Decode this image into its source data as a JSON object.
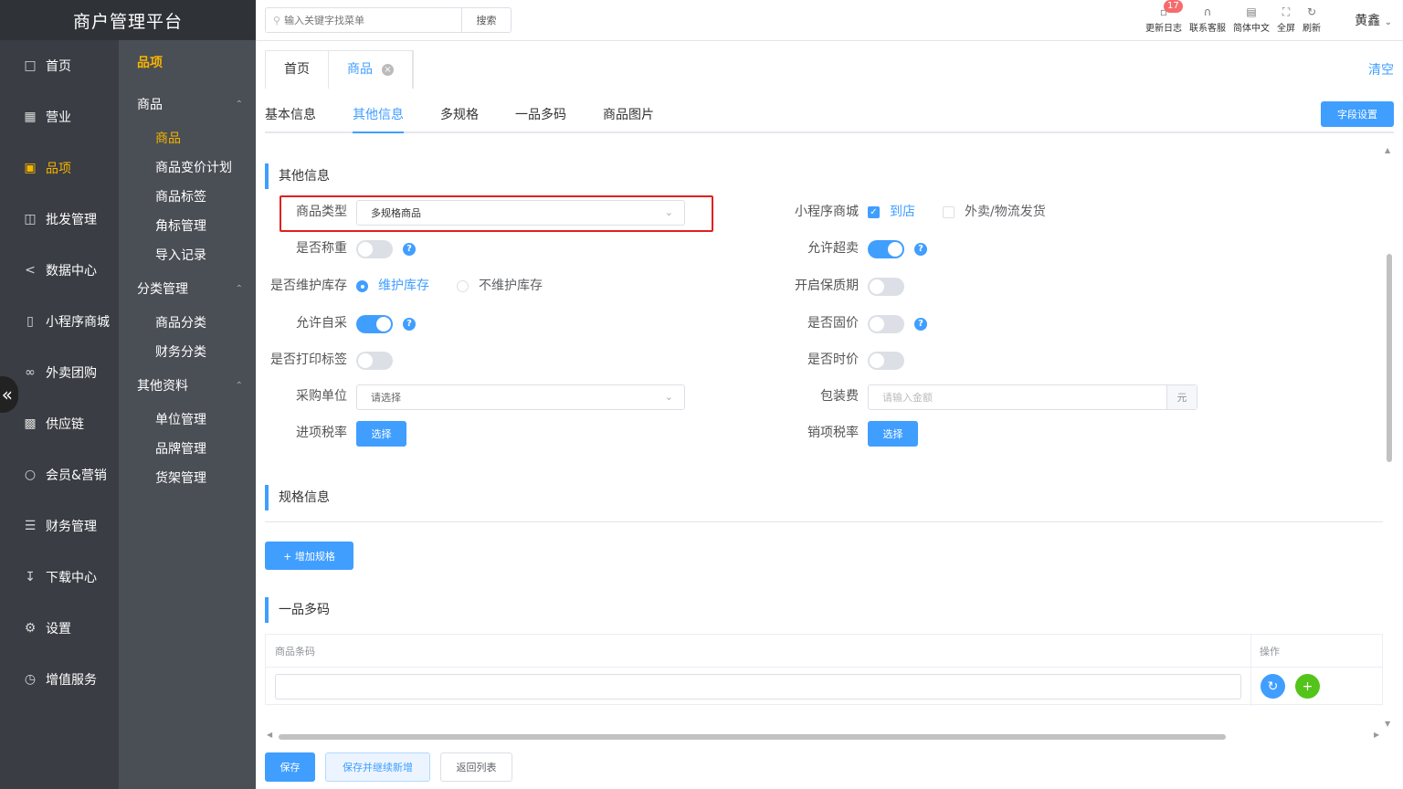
{
  "brand": "商户管理平台",
  "nav": [
    {
      "label": "首页",
      "icon": "home-icon"
    },
    {
      "label": "营业",
      "icon": "calendar-icon"
    },
    {
      "label": "品项",
      "icon": "bag-icon",
      "active": true
    },
    {
      "label": "批发管理",
      "icon": "cart-icon"
    },
    {
      "label": "数据中心",
      "icon": "share-icon"
    },
    {
      "label": "小程序商城",
      "icon": "phone-icon"
    },
    {
      "label": "外卖团购",
      "icon": "bike-icon"
    },
    {
      "label": "供应链",
      "icon": "truck-icon"
    },
    {
      "label": "会员&营销",
      "icon": "user-icon"
    },
    {
      "label": "财务管理",
      "icon": "database-icon"
    },
    {
      "label": "下载中心",
      "icon": "download-icon"
    },
    {
      "label": "设置",
      "icon": "gear-icon"
    },
    {
      "label": "增值服务",
      "icon": "clock-icon"
    }
  ],
  "subnav": {
    "title": "品项",
    "groups": [
      {
        "label": "商品",
        "items": [
          "商品",
          "商品变价计划",
          "商品标签",
          "角标管理",
          "导入记录"
        ]
      },
      {
        "label": "分类管理",
        "items": [
          "商品分类",
          "财务分类"
        ]
      },
      {
        "label": "其他资料",
        "items": [
          "单位管理",
          "品牌管理",
          "货架管理"
        ]
      }
    ]
  },
  "header": {
    "search_placeholder": "输入关键字找菜单",
    "search_button": "搜索",
    "tools": [
      {
        "label": "更新日志",
        "icon": "log-icon",
        "badge": "17"
      },
      {
        "label": "联系客服",
        "icon": "headset-icon"
      },
      {
        "label": "简体中文",
        "icon": "language-icon"
      },
      {
        "label": "全屏",
        "icon": "fullscreen-icon"
      },
      {
        "label": "刷新",
        "icon": "refresh-icon"
      }
    ],
    "user": "黄鑫"
  },
  "page_tabs": [
    {
      "label": "首页"
    },
    {
      "label": "商品",
      "active": true
    }
  ],
  "clear_all": "清空",
  "inner_tabs": [
    "基本信息",
    "其他信息",
    "多规格",
    "一品多码",
    "商品图片"
  ],
  "field_settings": "字段设置",
  "other_info": {
    "title": "其他信息",
    "product_type_label": "商品类型",
    "product_type_value": "多规格商品",
    "mini_mall_label": "小程序商城",
    "mini_opt1": "到店",
    "mini_opt2": "外卖/物流发货",
    "weigh_label": "是否称重",
    "oversell_label": "允许超卖",
    "stock_label": "是否维护库存",
    "stock_opt1": "维护库存",
    "stock_opt2": "不维护库存",
    "shelf_life_label": "开启保质期",
    "self_purchase_label": "允许自采",
    "fixed_price_label": "是否固价",
    "print_label_label": "是否打印标签",
    "time_price_label": "是否时价",
    "purchase_unit_label": "采购单位",
    "purchase_unit_placeholder": "请选择",
    "packing_fee_label": "包装费",
    "packing_fee_placeholder": "请输入金额",
    "packing_fee_suffix": "元",
    "input_tax_label": "进项税率",
    "output_tax_label": "销项税率",
    "choose": "选择",
    "help": "?"
  },
  "spec_info": {
    "title": "规格信息",
    "add_button": "+ 增加规格"
  },
  "multi_code": {
    "title": "一品多码",
    "col_barcode": "商品条码",
    "col_action": "操作"
  },
  "footer": {
    "save": "保存",
    "save_continue": "保存并继续新增",
    "back": "返回列表"
  },
  "colors": {
    "primary": "#409eff",
    "accent": "#f5b400",
    "success": "#52c41a",
    "highlight": "#e02020"
  }
}
